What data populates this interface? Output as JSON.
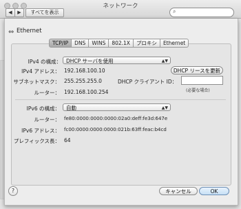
{
  "window": {
    "title": "ネットワーク"
  },
  "toolbar": {
    "back": "◀",
    "forward": "▶",
    "show_all": "すべてを表示",
    "search_icon": "⌕"
  },
  "interface": {
    "name": "Ethernet",
    "icon": "⇔"
  },
  "tabs": [
    "TCP/IP",
    "DNS",
    "WINS",
    "802.1X",
    "プロキシ",
    "Ethernet"
  ],
  "tcpip": {
    "ipv4_config_label": "IPv4 の構成：",
    "ipv4_config_value": "DHCP サーバを使用",
    "ipv4_addr_label": "IPv4 アドレス：",
    "ipv4_addr_value": "192.168.100.10",
    "dhcp_renew": "DHCP リースを更新",
    "subnet_label": "サブネットマスク：",
    "subnet_value": "255.255.255.0",
    "dhcp_client_label": "DHCP クライアント ID：",
    "dhcp_client_note": "(必要な場合)",
    "router_label": "ルーター：",
    "router_value": "192.168.100.254",
    "ipv6_config_label": "IPv6 の構成：",
    "ipv6_config_value": "自動",
    "ipv6_router_label": "ルーター：",
    "ipv6_router_value": "fe80:0000:0000:0000:02a0:deff:fe3d:647e",
    "ipv6_addr_label": "IPv6 アドレス：",
    "ipv6_addr_value": "fc00:0000:0000:0000:021b:63ff:feac:b4cd",
    "prefix_label": "プレフィックス長：",
    "prefix_value": "64"
  },
  "footer": {
    "help": "?",
    "cancel": "キャンセル",
    "ok": "OK"
  }
}
